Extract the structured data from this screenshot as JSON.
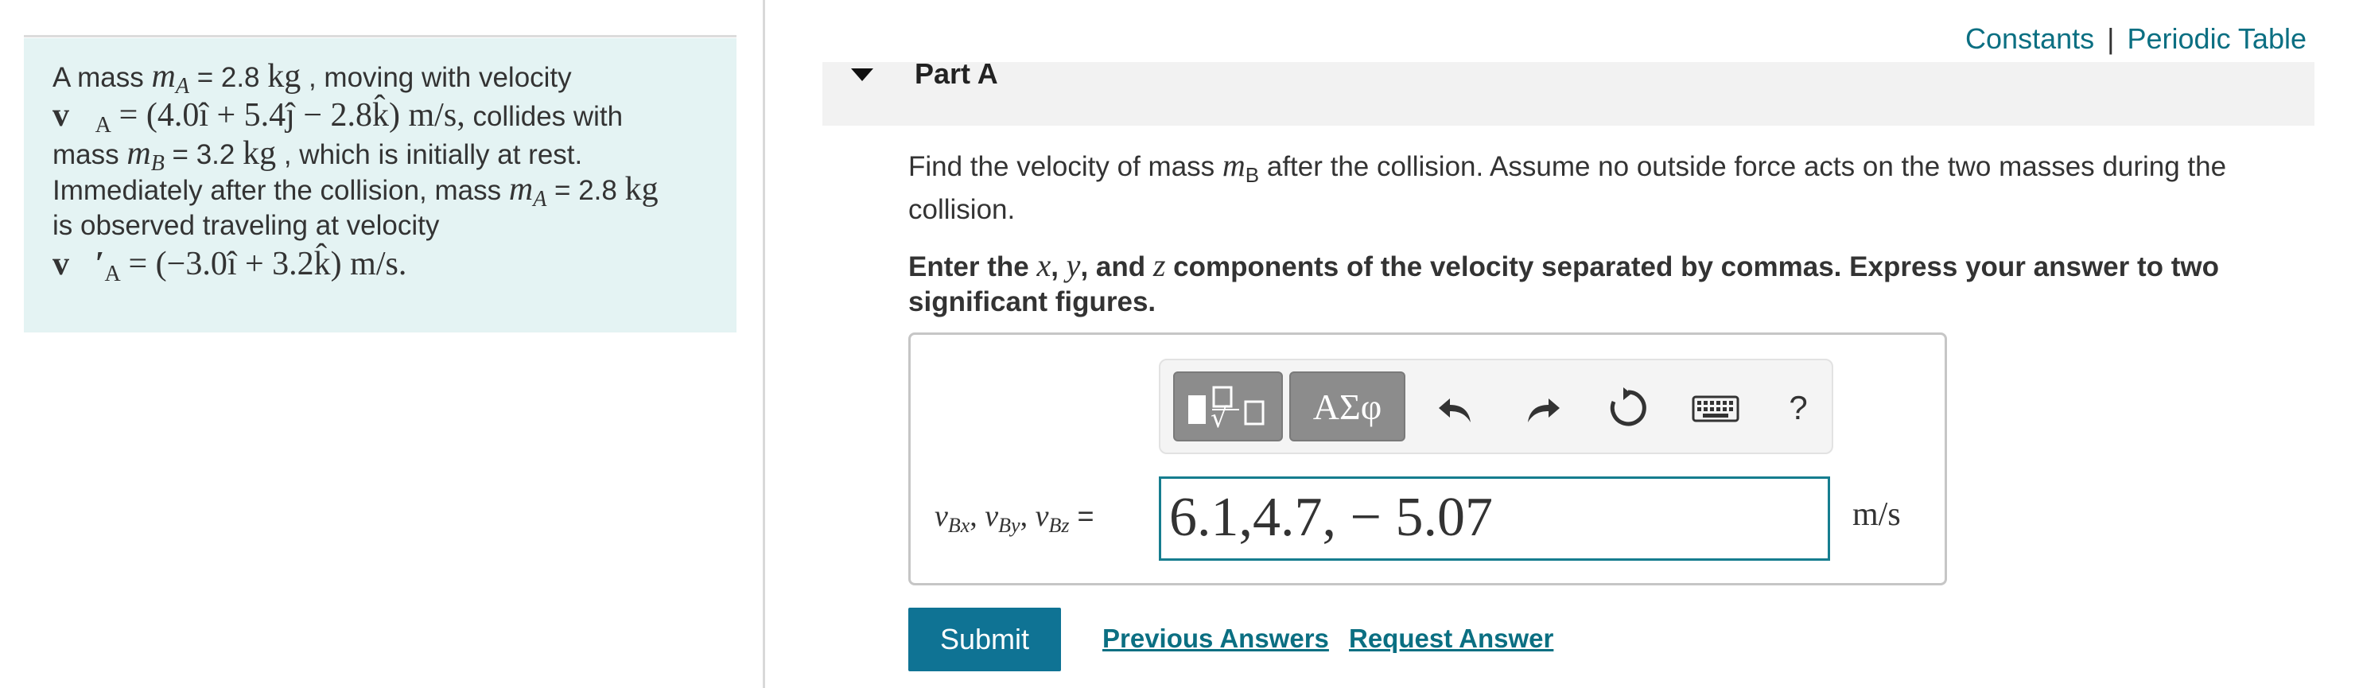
{
  "header_links": {
    "constants": "Constants",
    "separator": "|",
    "periodic_table": "Periodic Table"
  },
  "problem": {
    "line1_prefix": "A mass",
    "mass_a_symbol": "m",
    "mass_a_sub": "A",
    "line1_mass_value": "= 2.8",
    "unit_kg": "kg",
    "line1_suffix": ", moving with velocity",
    "vel_a_expr": "= (4.0î + 5.4ĵ − 2.8k̂) m/s,",
    "line2_suffix": "collides with",
    "line3_prefix": "mass",
    "mass_b_symbol": "m",
    "mass_b_sub": "B",
    "line3_mass_value": "= 3.2",
    "line3_suffix": ", which is initially at rest.",
    "line4_text": "Immediately after the collision, mass",
    "line4_mass_value": "= 2.8",
    "line5_text": "is observed traveling at velocity",
    "vel_a_prime_sub": "A",
    "vel_a_prime_expr": "= (−3.0î + 3.2k̂) m/s."
  },
  "part": {
    "title": "Part A"
  },
  "instructions": {
    "para1_prefix": "Find the velocity of mass",
    "para1_math": "m",
    "para1_sub": "B",
    "para1_suffix": "after the collision. Assume no outside force acts on the two masses during the collision.",
    "para2_prefix": "Enter the",
    "var_x": "x",
    "sep1": ",",
    "var_y": "y",
    "para2_and": ", and",
    "var_z": "z",
    "para2_suffix": "components of the velocity separated by commas. Express your answer to two significant figures."
  },
  "toolbar": {
    "symbols_label": "ΑΣφ",
    "help_label": "?"
  },
  "answer": {
    "label_math": "v",
    "label_sub_x": "Bx",
    "label_sub_y": "By",
    "label_sub_z": "Bz",
    "label_equals": "=",
    "value": "6.1,4.7, − 5.07",
    "unit": "m/s"
  },
  "actions": {
    "submit": "Submit",
    "previous_answers": "Previous Answers",
    "request_answer": "Request Answer"
  },
  "colors": {
    "panel_bg": "#e4f3f3",
    "link": "#0b6f82",
    "submit_bg": "#0f7394",
    "input_border": "#167d8f"
  },
  "icons": [
    "templates-icon",
    "undo-icon",
    "redo-icon",
    "reset-icon",
    "keyboard-icon",
    "help-icon",
    "collapse-triangle-icon"
  ]
}
